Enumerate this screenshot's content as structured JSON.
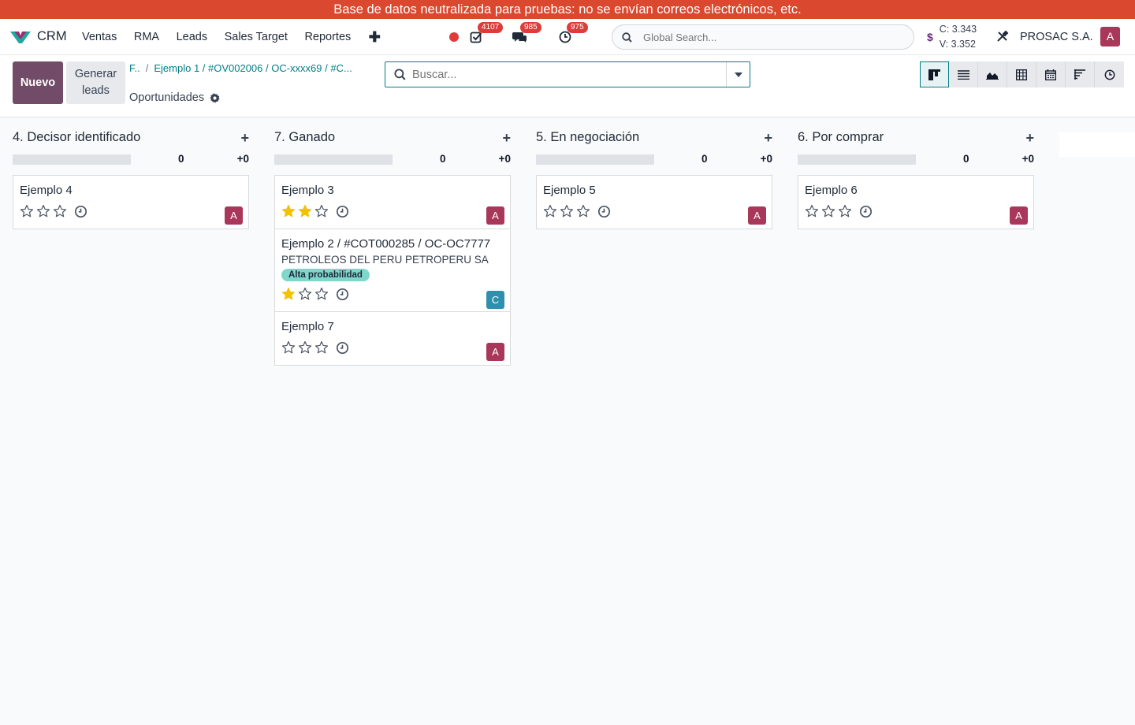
{
  "banner": "Base de datos neutralizada para pruebas: no se envían correos electrónicos, etc.",
  "app_name": "CRM",
  "menu": [
    "Ventas",
    "RMA",
    "Leads",
    "Sales Target",
    "Reportes"
  ],
  "systray": {
    "activities": "4107",
    "messages": "985",
    "timesheets": "975"
  },
  "global_search_placeholder": "Global Search...",
  "currency": {
    "symbol": "$",
    "buy": "C: 3.343",
    "sell": "V: 3.352"
  },
  "company": "PROSAC S.A.",
  "user_initial": "A",
  "control": {
    "new_label": "Nuevo",
    "generate_label": "Generar leads",
    "breadcrumb_root": "F..",
    "breadcrumb_current": "Ejemplo 1 / #OV002006 / OC-xxxx69 / #C...",
    "title": "Oportunidades",
    "search_placeholder": "Buscar..."
  },
  "columns": [
    {
      "title": "4. Decisor identificado",
      "count": "0",
      "sum": "+0",
      "cards": [
        {
          "title": "Ejemplo 4",
          "stars": 0,
          "avatar": "A",
          "avatar_color": "#a9375a"
        }
      ]
    },
    {
      "title": "7. Ganado",
      "count": "0",
      "sum": "+0",
      "cards": [
        {
          "title": "Ejemplo 3",
          "stars": 2,
          "avatar": "A",
          "avatar_color": "#a9375a"
        },
        {
          "title": "Ejemplo 2 / #COT000285 / OC-OC7777",
          "subtitle": "PETROLEOS DEL PERU PETROPERU SA",
          "tag": "Alta probabilidad",
          "stars": 1,
          "avatar": "C",
          "avatar_color": "#2f8fae"
        },
        {
          "title": "Ejemplo 7",
          "stars": 0,
          "avatar": "A",
          "avatar_color": "#a9375a"
        }
      ]
    },
    {
      "title": "5. En negociación",
      "count": "0",
      "sum": "+0",
      "cards": [
        {
          "title": "Ejemplo 5",
          "stars": 0,
          "avatar": "A",
          "avatar_color": "#a9375a"
        }
      ]
    },
    {
      "title": "6. Por comprar",
      "count": "0",
      "sum": "+0",
      "cards": [
        {
          "title": "Ejemplo 6",
          "stars": 0,
          "avatar": "A",
          "avatar_color": "#a9375a"
        }
      ]
    }
  ],
  "colors": {
    "brand": "#714b67",
    "accent": "#017e84",
    "banner": "#d9482f",
    "star": "#f3c200"
  }
}
